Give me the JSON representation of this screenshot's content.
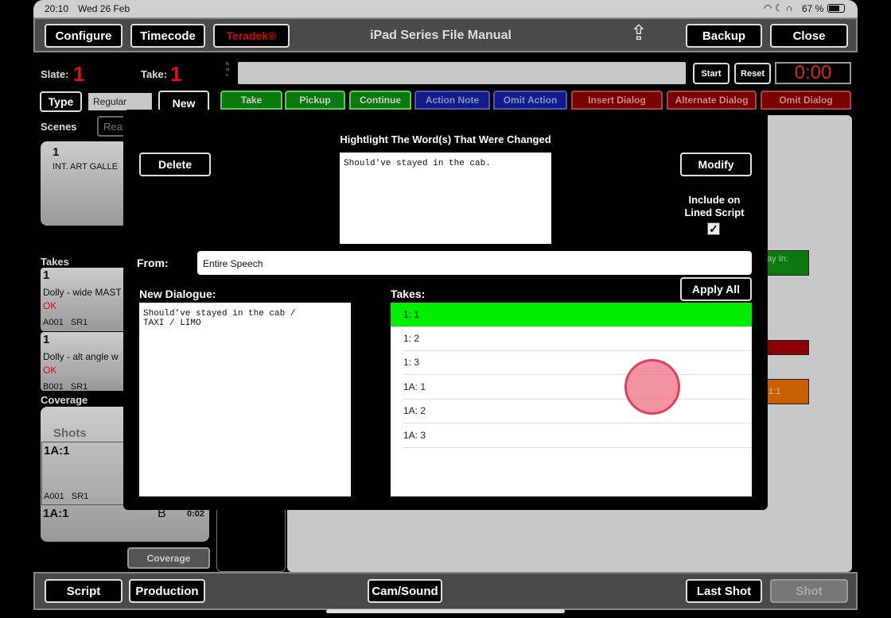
{
  "status": {
    "time": "20:10",
    "date": "Wed 26 Feb",
    "battery": "67 %"
  },
  "header": {
    "title": "iPad Series File Manual",
    "configure": "Configure",
    "timecode": "Timecode",
    "teradek": "Teradek®",
    "backup": "Backup",
    "close": "Close",
    "share_icon": "share-icon"
  },
  "slate": {
    "slate_label": "Slate:",
    "slate_value": "1",
    "take_label": "Take:",
    "take_value": "1",
    "note_label": "Note",
    "note_value": ""
  },
  "timer": {
    "start": "Start",
    "reset": "Reset",
    "value": "0:00"
  },
  "type": {
    "type_label": "Type",
    "type_value": "Regular",
    "new": "New"
  },
  "take_buttons": [
    {
      "label": "Take"
    },
    {
      "label": "Pickup"
    },
    {
      "label": "Continue"
    },
    {
      "label": "Action Note"
    },
    {
      "label": "Omit Action"
    },
    {
      "label": "Insert Dialog"
    },
    {
      "label": "Alternate Dialog"
    },
    {
      "label": "Omit Dialog"
    }
  ],
  "scenes": {
    "label": "Scenes",
    "rearrange": "Rear",
    "items": [
      {
        "number": "1",
        "name": "INT. ART GALLE"
      }
    ]
  },
  "takes": {
    "label": "Takes",
    "items": [
      {
        "number": "1",
        "desc": "Dolly - wide MAST",
        "status": "OK",
        "cam": "A001",
        "sound": "SR1"
      },
      {
        "number": "1",
        "desc": "Dolly - alt angle w",
        "status": "OK",
        "cam": "B001",
        "sound": "SR1"
      }
    ]
  },
  "coverage": {
    "label": "Coverage",
    "shots_label": "Shots",
    "items": [
      {
        "shot": "1A:1",
        "cam": "A001",
        "sound": "SR1"
      },
      {
        "shot": "1A:1",
        "camera": "B",
        "duration": "0:02"
      }
    ],
    "button": "Coverage"
  },
  "right_panel": {
    "play_in": "ay In:",
    "orange_label": "1:1"
  },
  "modal": {
    "title": "Hightlight The Word(s) That Were Changed",
    "delete": "Delete",
    "modify": "Modify",
    "original_text": "Should've stayed in the cab.",
    "include_label_1": "Include on",
    "include_label_2": "Lined Script",
    "include_checked": true,
    "from_label": "From:",
    "from_value": "Entire Speech",
    "new_dialogue_label": "New Dialogue:",
    "new_dialogue_line1": "Should’ve stayed in the cab /",
    "new_dialogue_line2": "TAXI / LIMO",
    "takes_label": "Takes:",
    "apply_all": "Apply All",
    "takes": [
      "1: 1",
      "1: 2",
      "1: 3",
      "1A: 1",
      "1A: 2",
      "1A: 3"
    ],
    "selected_take": "1: 1"
  },
  "bottom": {
    "script": "Script",
    "production": "Production",
    "camsound": "Cam/Sound",
    "last_shot": "Last Shot",
    "shot": "Shot"
  },
  "colors": {
    "accent_red": "#e01010",
    "selected_green": "#00ee00",
    "touch": "#f08090"
  }
}
